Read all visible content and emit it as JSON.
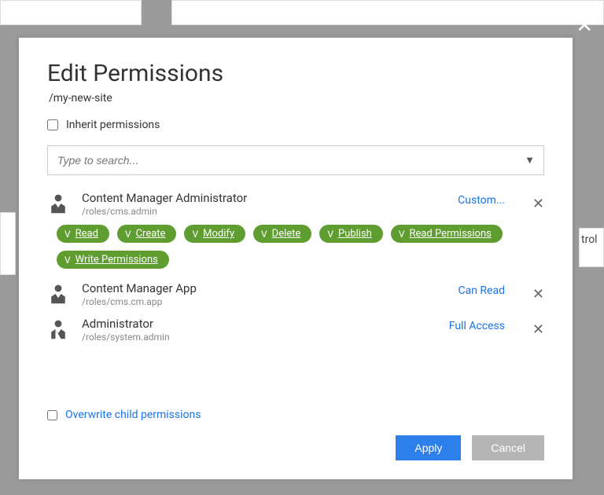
{
  "dialog": {
    "title": "Edit Permissions",
    "path": "/my-new-site",
    "inherit_label": "Inherit permissions",
    "search_placeholder": "Type to search...",
    "overwrite_label": "Overwrite child permissions",
    "apply_label": "Apply",
    "cancel_label": "Cancel"
  },
  "entries": [
    {
      "name": "Content Manager Administrator",
      "path": "/roles/cms.admin",
      "access": "Custom...",
      "perms": [
        "Read",
        "Create",
        "Modify",
        "Delete",
        "Publish",
        "Read Permissions",
        "Write Permissions"
      ]
    },
    {
      "name": "Content Manager App",
      "path": "/roles/cms.cm.app",
      "access": "Can Read"
    },
    {
      "name": "Administrator",
      "path": "/roles/system.admin",
      "access": "Full Access"
    }
  ]
}
